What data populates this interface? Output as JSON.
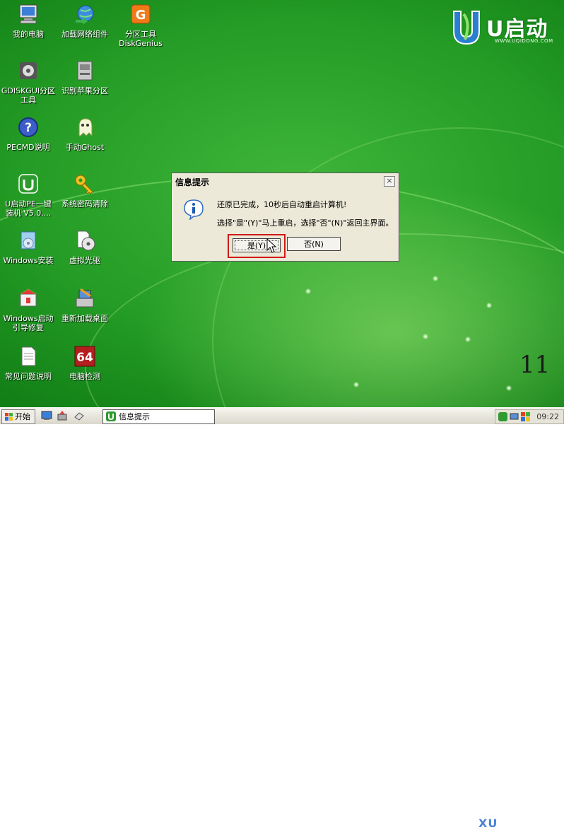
{
  "desktop": {
    "icons": [
      {
        "label": "我的电脑",
        "icon": "computer-icon"
      },
      {
        "label": "加载网络组件",
        "icon": "network-globe-icon"
      },
      {
        "label": "分区工具\nDiskGenius",
        "icon": "diskgenius-icon"
      },
      {
        "label": "GDISKGUI分区\n工具",
        "icon": "partition-tool-icon"
      },
      {
        "label": "识别苹果分区",
        "icon": "apple-partition-icon"
      },
      {
        "label": "PECMD说明",
        "icon": "help-icon"
      },
      {
        "label": "手动Ghost",
        "icon": "ghost-icon"
      },
      {
        "label": "U启动PE一键\n装机 V5.0....",
        "icon": "installer-icon"
      },
      {
        "label": "系统密码清除",
        "icon": "key-icon"
      },
      {
        "label": "Windows安装",
        "icon": "windows-install-icon"
      },
      {
        "label": "虚拟光驱",
        "icon": "virtual-drive-icon"
      },
      {
        "label": "Windows启动\n引导修复",
        "icon": "boot-repair-icon"
      },
      {
        "label": "重新加载桌面",
        "icon": "reload-desktop-icon"
      },
      {
        "label": "常见问题说明",
        "icon": "document-icon"
      },
      {
        "label": "电脑检测",
        "icon": "hardware-check-icon"
      }
    ],
    "logo_text": "U启动",
    "logo_url": "WWW.UQIDONG.COM",
    "page_number": "11",
    "colors": {
      "background": "#249c25",
      "highlight": "#d01818"
    }
  },
  "dialog": {
    "title": "信息提示",
    "close_label": "×",
    "message_line1": "还原已完成，10秒后自动重启计算机!",
    "message_line2": "选择\"是\"(Y)\"马上重启，选择\"否\"(N)\"返回主界面。",
    "yes_label": "是(Y)",
    "no_label": "否(N)",
    "icon": "info-icon"
  },
  "taskbar": {
    "start_label": "开始",
    "task_label": "信息提示",
    "clock": "09:22",
    "watermark": "XU"
  }
}
